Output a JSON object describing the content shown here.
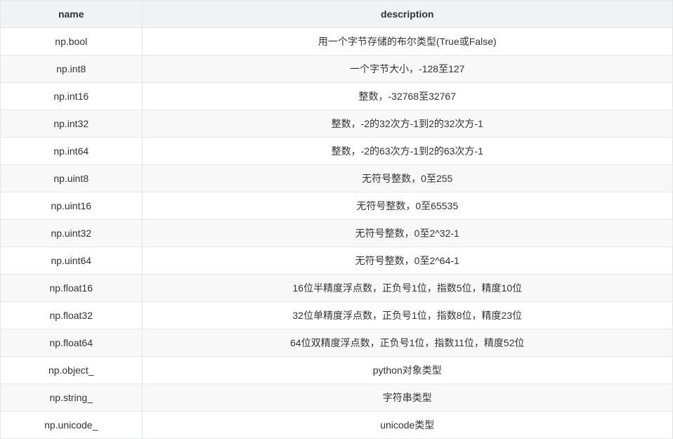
{
  "table": {
    "headers": {
      "name": "name",
      "description": "description"
    },
    "rows": [
      {
        "name": "np.bool",
        "description": "用一个字节存储的布尔类型(True或False)"
      },
      {
        "name": "np.int8",
        "description": "一个字节大小，-128至127"
      },
      {
        "name": "np.int16",
        "description": "整数，-32768至32767"
      },
      {
        "name": "np.int32",
        "description": "整数，-2的32次方-1到2的32次方-1"
      },
      {
        "name": "np.int64",
        "description": "整数，-2的63次方-1到2的63次方-1"
      },
      {
        "name": "np.uint8",
        "description": "无符号整数，0至255"
      },
      {
        "name": "np.uint16",
        "description": "无符号整数，0至65535"
      },
      {
        "name": "np.uint32",
        "description": "无符号整数，0至2^32-1"
      },
      {
        "name": "np.uint64",
        "description": "无符号整数，0至2^64-1"
      },
      {
        "name": "np.float16",
        "description": "16位半精度浮点数，正负号1位，指数5位，精度10位"
      },
      {
        "name": "np.float32",
        "description": "32位单精度浮点数，正负号1位，指数8位，精度23位"
      },
      {
        "name": "np.float64",
        "description": "64位双精度浮点数，正负号1位，指数11位，精度52位"
      },
      {
        "name": "np.object_",
        "description": "python对象类型"
      },
      {
        "name": "np.string_",
        "description": "字符串类型"
      },
      {
        "name": "np.unicode_",
        "description": "unicode类型"
      }
    ]
  }
}
